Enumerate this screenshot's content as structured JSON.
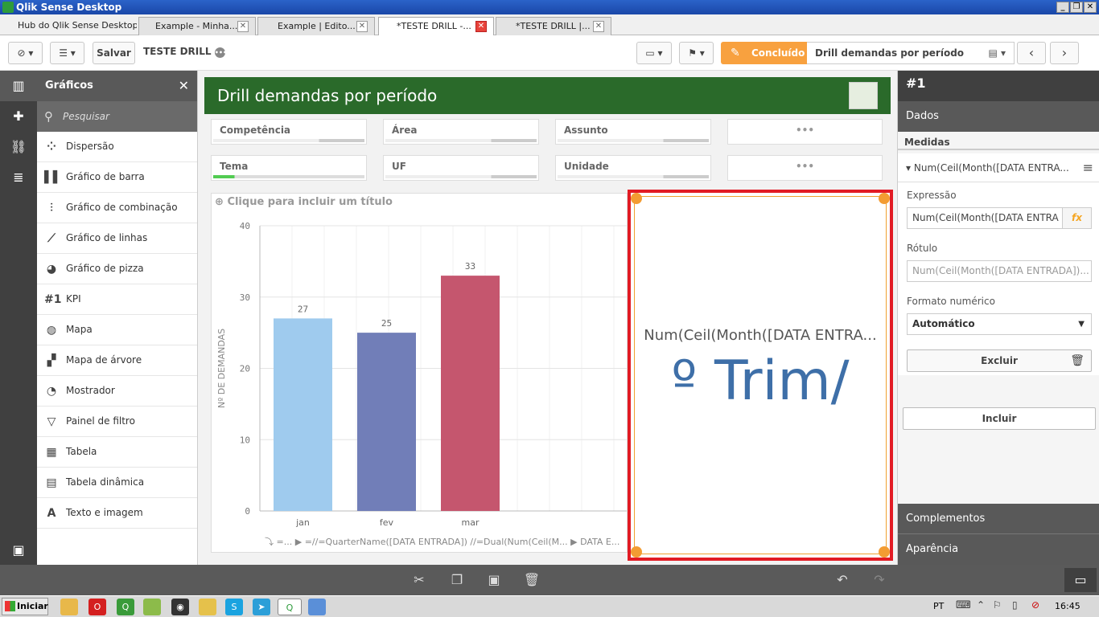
{
  "window": {
    "title": "Qlik Sense Desktop"
  },
  "tabs": [
    {
      "label": "Hub do Qlik Sense Desktop"
    },
    {
      "label": "Example - Minha..."
    },
    {
      "label": "Example | Edito..."
    },
    {
      "label": "*TESTE DRILL -..."
    },
    {
      "label": "*TESTE DRILL |..."
    }
  ],
  "toolbar": {
    "save_label": "Salvar",
    "app_name": "TESTE DRILL",
    "done_label": "Concluído",
    "sheet_name": "Drill demandas por período"
  },
  "assets": {
    "title": "Gráficos",
    "search_placeholder": "Pesquisar",
    "items": [
      {
        "label": "Dispersão",
        "icon": "scatter-icon"
      },
      {
        "label": "Gráfico de barra",
        "icon": "bar-chart-icon"
      },
      {
        "label": "Gráfico de combinação",
        "icon": "combo-chart-icon"
      },
      {
        "label": "Gráfico de linhas",
        "icon": "line-chart-icon"
      },
      {
        "label": "Gráfico de pizza",
        "icon": "pie-chart-icon"
      },
      {
        "label": "KPI",
        "icon": "kpi-icon"
      },
      {
        "label": "Mapa",
        "icon": "globe-icon"
      },
      {
        "label": "Mapa de árvore",
        "icon": "treemap-icon"
      },
      {
        "label": "Mostrador",
        "icon": "gauge-icon"
      },
      {
        "label": "Painel de filtro",
        "icon": "filter-pane-icon"
      },
      {
        "label": "Tabela",
        "icon": "table-icon"
      },
      {
        "label": "Tabela dinâmica",
        "icon": "pivot-table-icon"
      },
      {
        "label": "Texto e imagem",
        "icon": "text-image-icon"
      }
    ]
  },
  "sheet": {
    "title": "Drill demandas por período",
    "filters_row1": [
      "Competência",
      "Área",
      "Assunto",
      "•••"
    ],
    "filters_row2": [
      "Tema",
      "UF",
      "Unidade",
      "•••"
    ]
  },
  "chart": {
    "placeholder_title": "Clique para incluir um título",
    "drill_path": [
      {
        "label": "=..."
      },
      {
        "label": "=//=QuarterName([DATA ENTRADA]) //=Dual(Num(Ceil(M..."
      },
      {
        "label": "DATA E..."
      }
    ]
  },
  "chart_data": {
    "type": "bar",
    "categories": [
      "jan",
      "fev",
      "mar"
    ],
    "values": [
      27,
      25,
      33
    ],
    "colors": [
      "#9fcbee",
      "#717eb8",
      "#c5566e"
    ],
    "ylabel": "Nº DE DEMANDAS",
    "yticks": [
      0,
      10,
      20,
      30,
      40
    ],
    "ylim": [
      0,
      40
    ]
  },
  "kpi": {
    "label": "Num(Ceil(Month([DATA ENTRA...",
    "value": "º Trim/"
  },
  "props": {
    "header": "#1",
    "data_section": "Dados",
    "measures_label": "Medidas",
    "measure_name": "Num(Ceil(Month([DATA ENTRA...",
    "expression_label": "Expressão",
    "expression_value": "Num(Ceil(Month([DATA ENTRA",
    "label_label": "Rótulo",
    "label_placeholder": "Num(Ceil(Month([DATA ENTRADA])...",
    "number_format_label": "Formato numérico",
    "number_format_value": "Automático",
    "delete_label": "Excluir",
    "include_label": "Incluir",
    "addons_label": "Complementos",
    "appearance_label": "Aparência"
  },
  "taskbar": {
    "start_label": "Iniciar",
    "lang": "PT",
    "clock": "16:45"
  }
}
